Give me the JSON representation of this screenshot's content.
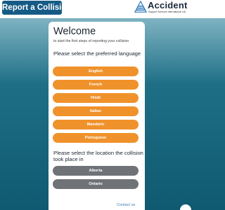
{
  "header": {
    "report_button": "Report a Collision",
    "brand": {
      "name": "Accident",
      "tagline": "Support Services International Ltd.",
      "logo_icon": "triangle-stripes-logo",
      "logo_color": "#1f6fb5"
    }
  },
  "card": {
    "title": "Welcome",
    "intro": "to start the first steps of reporting your collision",
    "language_heading": "Please select the preferred language",
    "languages": [
      "English",
      "French",
      "Hindi",
      "Italian",
      "Mandarin",
      "Portuguese"
    ],
    "location_heading": "Please select the location the collision took place in",
    "locations": [
      "Alberta",
      "Ontario"
    ],
    "contact_link": "Contact us"
  },
  "colors": {
    "language_button": "#f0922b",
    "location_button": "#6f7378",
    "report_button": "#165b86",
    "background": "#1e6f86"
  }
}
